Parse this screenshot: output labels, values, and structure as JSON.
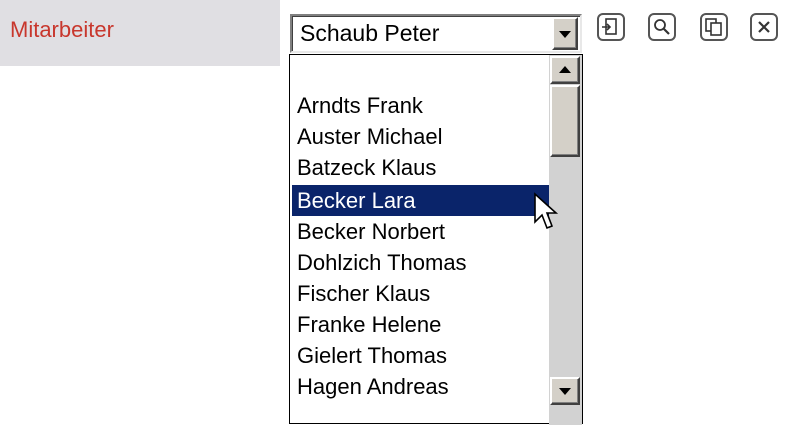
{
  "field": {
    "label": "Mitarbeiter",
    "selected_value": "Schaub Peter"
  },
  "toolbar": {
    "icons": [
      "open-icon",
      "search-icon",
      "copy-icon",
      "clear-icon"
    ]
  },
  "dropdown": {
    "items": [
      "",
      "Arndts Frank",
      "Auster Michael",
      "Batzeck Klaus",
      "Becker Lara",
      "Becker Norbert",
      "Dohlzich Thomas",
      "Fischer Klaus",
      "Franke Helene",
      "Gielert Thomas",
      "Hagen Andreas"
    ],
    "highlighted_index": 4
  },
  "colors": {
    "label_text": "#c8372d",
    "label_background": "#e0dfe3",
    "selection_background": "#0a246a",
    "selection_text": "#ffffff"
  }
}
